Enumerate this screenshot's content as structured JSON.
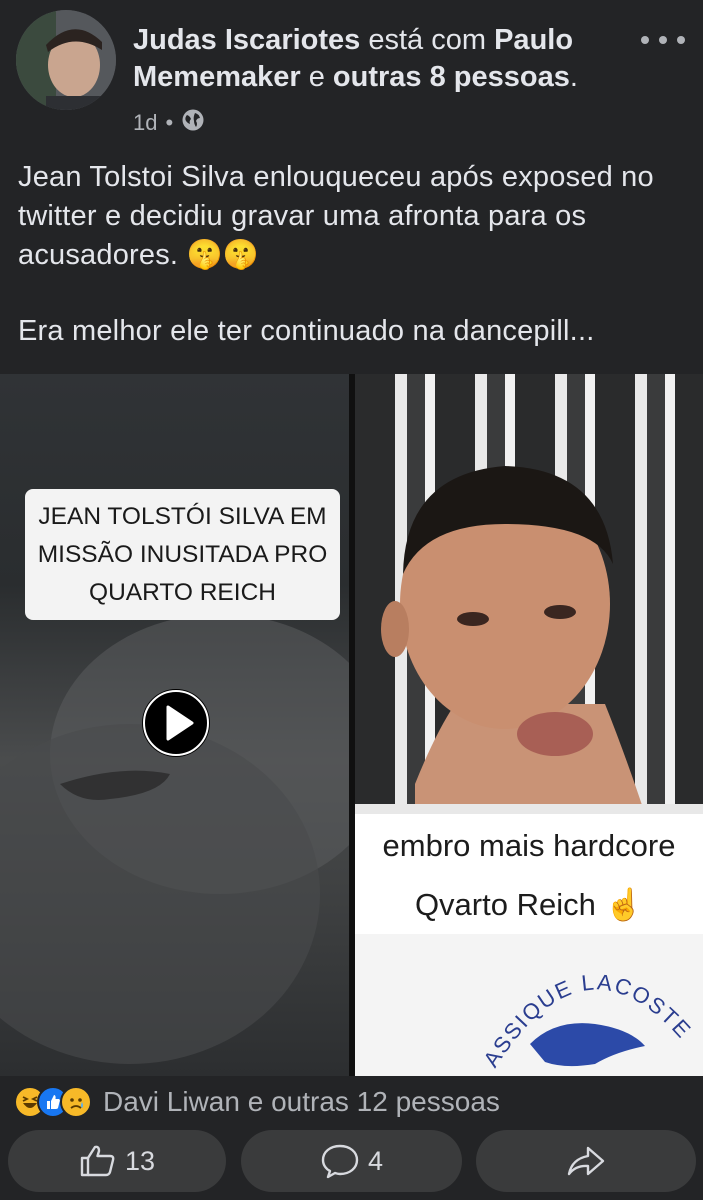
{
  "post": {
    "author": "Judas Iscariotes",
    "with_word": "está com",
    "tagged_person": "Paulo Mememaker",
    "and_word": "e",
    "others": "outras 8 pessoas",
    "period": ".",
    "time": "1d",
    "dot": "•",
    "caption_line1": "Jean Tolstoi Silva enlouqueceu após exposed no twitter e decidiu gravar uma afronta para os acusadores. 🤫🤫",
    "caption_line2": "Era melhor ele ter continuado na dancepill..."
  },
  "media": {
    "video_label_lines": [
      "JEAN TOLSTÓI SILVA EM",
      "MISSÃO INUSITADA PRO",
      "QUARTO REICH"
    ],
    "photo_caption_line1": "embro mais hardcore",
    "photo_caption_line2": "Qvarto Reich ☝️",
    "shirt_text": "ASSIQUE LACOSTE"
  },
  "reactions": {
    "icons": [
      "haha-icon",
      "like-icon",
      "sad-icon"
    ],
    "text": "Davi Liwan e outras 12 pessoas"
  },
  "actions": {
    "like_count": "13",
    "comment_count": "4"
  },
  "colors": {
    "background": "#232426",
    "text_primary": "#e4e6eb",
    "text_secondary": "#b0b3b8",
    "button_bg": "#3a3b3c",
    "like_blue": "#1877f2",
    "haha_yellow": "#f7b928"
  }
}
